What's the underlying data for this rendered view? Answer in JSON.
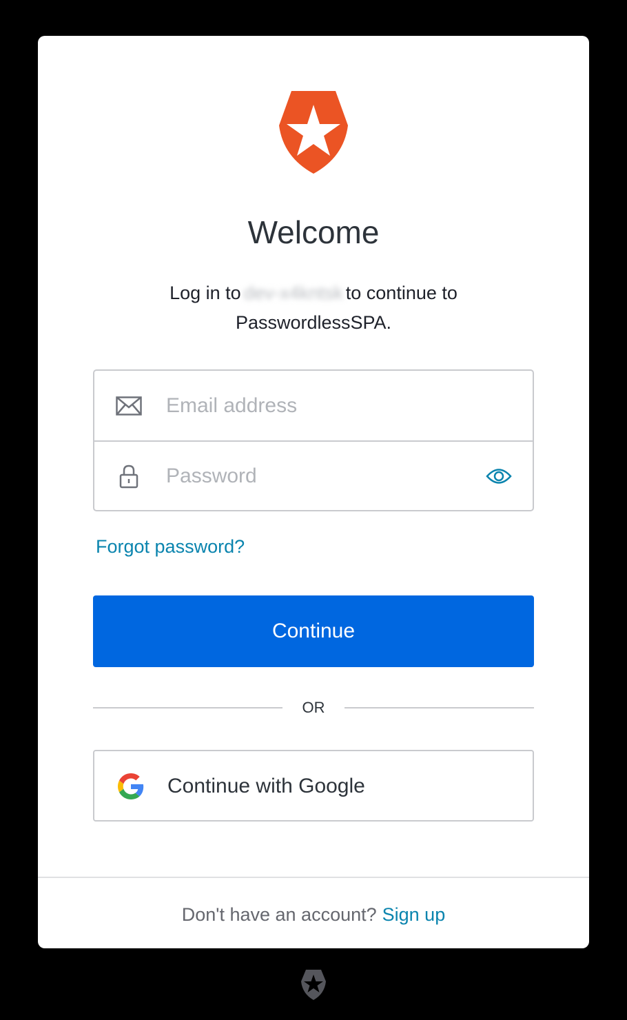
{
  "header": {
    "title": "Welcome",
    "subtitle_prefix": "Log in to",
    "tenant_name": "dev-x4kntsk",
    "subtitle_suffix": "to continue to",
    "app_name": "PasswordlessSPA."
  },
  "form": {
    "email_placeholder": "Email address",
    "email_value": "",
    "password_placeholder": "Password",
    "password_value": "",
    "forgot_password_label": "Forgot password?",
    "continue_label": "Continue"
  },
  "divider": {
    "label": "OR"
  },
  "social": {
    "google_label": "Continue with Google"
  },
  "footer": {
    "prompt": "Don't have an account?",
    "signup_label": "Sign up"
  },
  "icons": {
    "logo": "auth0-shield-icon",
    "email": "envelope-icon",
    "password": "lock-icon",
    "toggle_visibility": "eye-icon",
    "google": "google-g-icon"
  },
  "colors": {
    "brand_orange": "#eb5424",
    "primary_button": "#0067e0",
    "link": "#0a84ae",
    "text": "#2d333a",
    "border": "#c9cace",
    "page_background": "#000000"
  }
}
